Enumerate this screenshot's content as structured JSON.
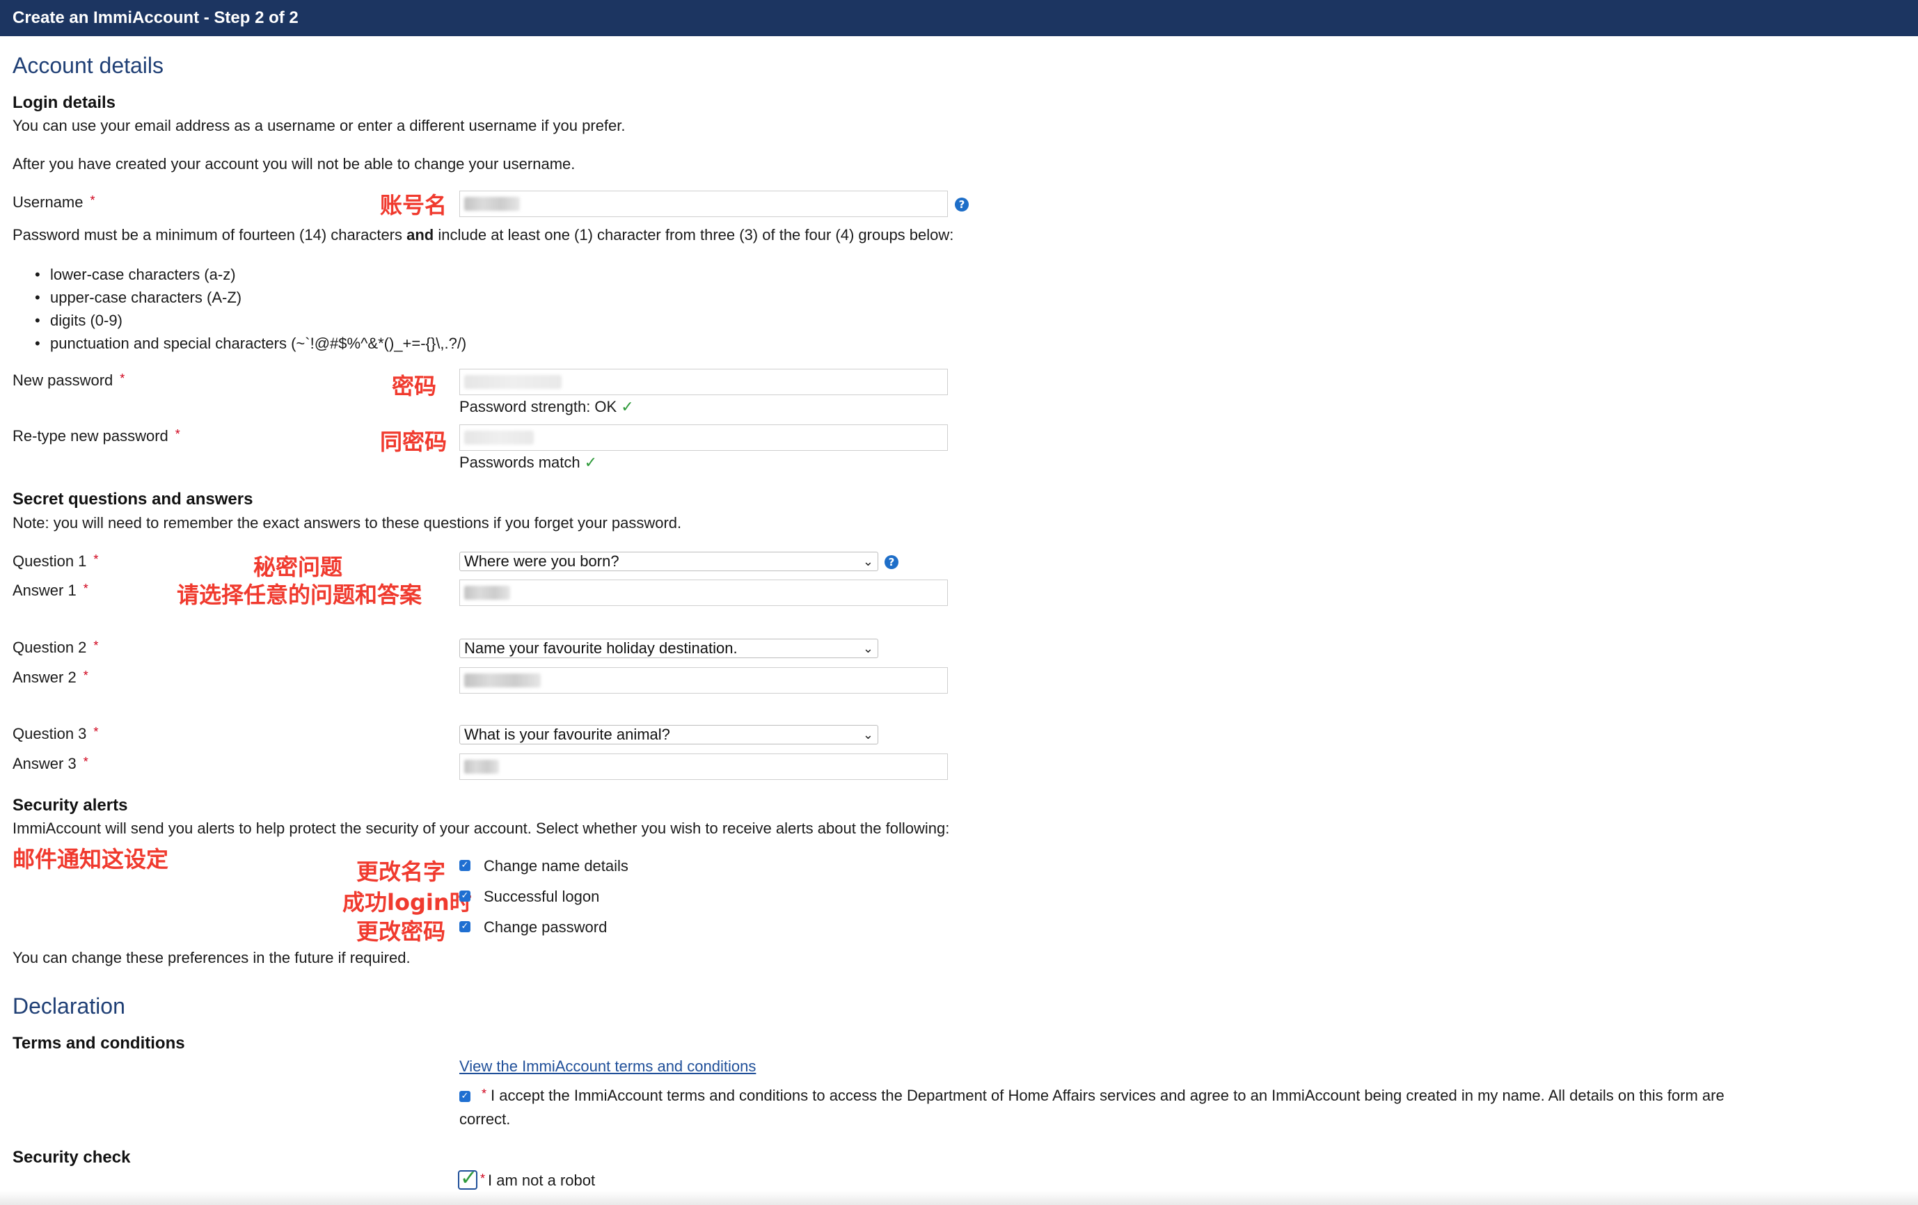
{
  "header": {
    "title": "Create an ImmiAccount - Step 2 of 2"
  },
  "account": {
    "heading": "Account details",
    "login_heading": "Login details",
    "login_intro1": "You can use your email address as a username or enter a different username if you prefer.",
    "login_intro2": "After you have created your account you will not be able to change your username.",
    "username_label": "Username",
    "required_mark": "*",
    "password_rule_prefix": "Password must be a minimum of fourteen (14) characters ",
    "password_rule_bold": "and",
    "password_rule_suffix": " include at least one (1) character from three (3) of the four (4) groups below:",
    "groups": [
      "lower-case characters (a-z)",
      "upper-case characters (A-Z)",
      "digits (0-9)",
      "punctuation and special characters (~`!@#$%^&*()_+=-{}\\,.?/)"
    ],
    "new_password_label": "New password",
    "password_strength": "Password strength: OK",
    "retype_label": "Re-type new password",
    "passwords_match": "Passwords match"
  },
  "secret": {
    "heading": "Secret questions and answers",
    "note": "Note: you will need to remember the exact answers to these questions if you forget your password.",
    "items": [
      {
        "q_label": "Question 1",
        "a_label": "Answer 1",
        "selected": "Where were you born?"
      },
      {
        "q_label": "Question 2",
        "a_label": "Answer 2",
        "selected": "Name your favourite holiday destination."
      },
      {
        "q_label": "Question 3",
        "a_label": "Answer 3",
        "selected": "What is your favourite animal?"
      }
    ]
  },
  "alerts": {
    "heading": "Security alerts",
    "intro": "ImmiAccount will send you alerts to help protect the security of your account. Select whether you wish to receive alerts about the following:",
    "options": [
      {
        "label": "Change name details",
        "checked": true
      },
      {
        "label": "Successful logon",
        "checked": true
      },
      {
        "label": "Change password",
        "checked": true
      }
    ],
    "footer": "You can change these preferences in the future if required."
  },
  "declaration": {
    "heading": "Declaration",
    "terms_heading": "Terms and conditions",
    "terms_link": "View the ImmiAccount terms and conditions",
    "accept_line1": "I accept the ImmiAccount terms and conditions to access the Department of Home Affairs services and agree to an ImmiAccount being created in my name. All details on this form are",
    "accept_line2": "correct.",
    "security_check_heading": "Security check",
    "robot_label": "I am not a robot"
  },
  "annotations": {
    "username": "账号名",
    "password": "密码",
    "retype": "同密码",
    "secret_q": "秘密问题",
    "secret_hint": "请选择任意的问题和答案",
    "email_alerts": "邮件通知这设定",
    "alert_name": "更改名字",
    "alert_logon": "成功login时",
    "alert_password": "更改密码"
  },
  "colors": {
    "header_bg": "#1c3561",
    "heading_blue": "#1f3f75",
    "annotation_red": "#f03a2e",
    "required_red": "#d0021b",
    "check_blue": "#1f6fd1",
    "ok_green": "#2e9a3a"
  },
  "icons": {
    "help": "question-circle-icon",
    "tick": "checkmark-icon",
    "dropdown": "chevron-down-icon"
  }
}
